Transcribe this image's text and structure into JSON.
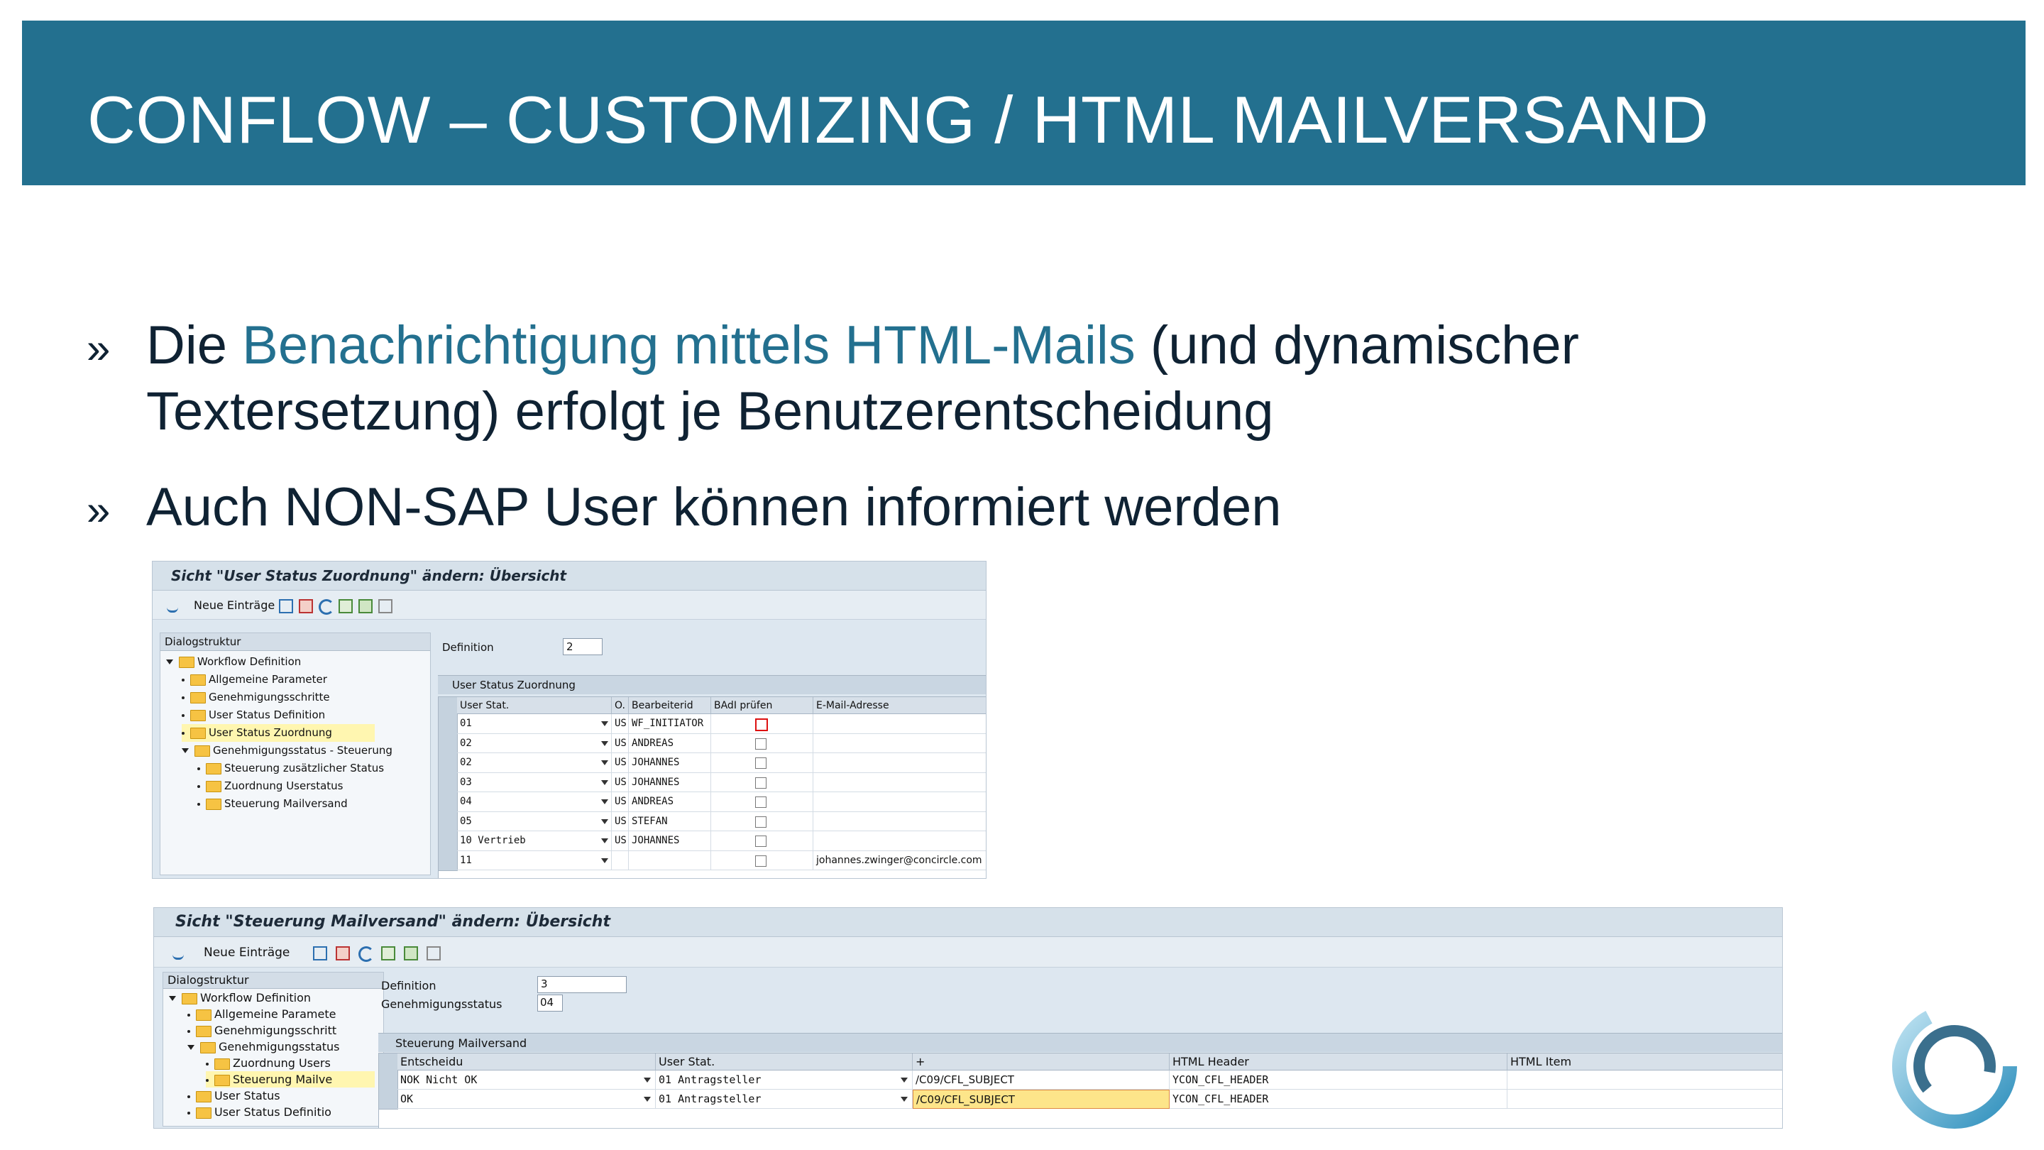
{
  "slide": {
    "title": "CONFLOW – CUSTOMIZING / HTML MAILVERSAND",
    "bullet_mark": "»",
    "bullet1_pre": "Die ",
    "bullet1_hl": "Benachrichtigung mittels HTML-Mails",
    "bullet1_post": " (und dynamischer",
    "bullet1_line2": "Textersetzung) erfolgt je Benutzerentscheidung",
    "bullet2": "Auch NON-SAP User können informiert werden"
  },
  "colors": {
    "accent": "#23708f",
    "text": "#0f2233",
    "highlight_row": "#fff6b0"
  },
  "screen1": {
    "title": "Sicht \"User Status Zuordnung\" ändern: Übersicht",
    "toolbar_label": "Neue Einträge",
    "tree_header": "Dialogstruktur",
    "tree": [
      {
        "label": "Workflow Definition",
        "level": 0,
        "type": "open"
      },
      {
        "label": "Allgemeine Parameter",
        "level": 1,
        "type": "leaf"
      },
      {
        "label": "Genehmigungsschritte",
        "level": 1,
        "type": "leaf"
      },
      {
        "label": "User Status Definition",
        "level": 1,
        "type": "leaf"
      },
      {
        "label": "User Status Zuordnung",
        "level": 1,
        "type": "leaf",
        "selected": true
      },
      {
        "label": "Genehmigungsstatus - Steuerung",
        "level": 1,
        "type": "open"
      },
      {
        "label": "Steuerung zusätzlicher Status",
        "level": 2,
        "type": "leaf"
      },
      {
        "label": "Zuordnung Userstatus",
        "level": 2,
        "type": "leaf"
      },
      {
        "label": "Steuerung Mailversand",
        "level": 2,
        "type": "leaf"
      }
    ],
    "definition_label": "Definition",
    "definition_value": "2",
    "section_title": "User Status Zuordnung",
    "columns": [
      "User Stat.",
      "O.",
      "Bearbeiterid",
      "BAdI prüfen",
      "E-Mail-Adresse"
    ],
    "rows": [
      {
        "stat": "01",
        "o": "US",
        "id": "WF_INITIATOR",
        "mail": ""
      },
      {
        "stat": "02",
        "o": "US",
        "id": "ANDREAS",
        "mail": ""
      },
      {
        "stat": "02",
        "o": "US",
        "id": "JOHANNES",
        "mail": ""
      },
      {
        "stat": "03",
        "o": "US",
        "id": "JOHANNES",
        "mail": ""
      },
      {
        "stat": "04",
        "o": "US",
        "id": "ANDREAS",
        "mail": ""
      },
      {
        "stat": "05",
        "o": "US",
        "id": "STEFAN",
        "mail": ""
      },
      {
        "stat": "10 Vertrieb",
        "o": "US",
        "id": "JOHANNES",
        "mail": ""
      },
      {
        "stat": "11",
        "o": "",
        "id": "",
        "mail": "johannes.zwinger@concircle.com"
      }
    ]
  },
  "screen2": {
    "title": "Sicht \"Steuerung Mailversand\" ändern: Übersicht",
    "toolbar_label": "Neue Einträge",
    "tree_header": "Dialogstruktur",
    "tree": [
      {
        "label": "Workflow Definition",
        "level": 0,
        "type": "open"
      },
      {
        "label": "Allgemeine Paramete",
        "level": 1,
        "type": "leaf"
      },
      {
        "label": "Genehmigungsschritt",
        "level": 1,
        "type": "leaf"
      },
      {
        "label": "Genehmigungsstatus",
        "level": 1,
        "type": "open"
      },
      {
        "label": "Zuordnung Users",
        "level": 2,
        "type": "leaf"
      },
      {
        "label": "Steuerung Mailve",
        "level": 2,
        "type": "leaf",
        "selected": true
      },
      {
        "label": "User Status",
        "level": 1,
        "type": "leaf"
      },
      {
        "label": "User Status Definitio",
        "level": 1,
        "type": "leaf"
      }
    ],
    "definition_label": "Definition",
    "definition_value": "3",
    "status_label": "Genehmigungsstatus",
    "status_value": "04",
    "section_title": "Steuerung Mailversand",
    "columns": [
      "Entscheidu",
      "User Stat.",
      "+",
      "HTML Header",
      "HTML Item"
    ],
    "rows": [
      {
        "ent": "NOK Nicht OK",
        "stat": "01 Antragsteller",
        "plus": "/C09/CFL_SUBJECT",
        "header": "YCON_CFL_HEADER",
        "item": ""
      },
      {
        "ent": "OK",
        "stat": "01 Antragsteller",
        "plus": "/C09/CFL_SUBJECT",
        "header": "YCON_CFL_HEADER",
        "item": ""
      }
    ]
  }
}
